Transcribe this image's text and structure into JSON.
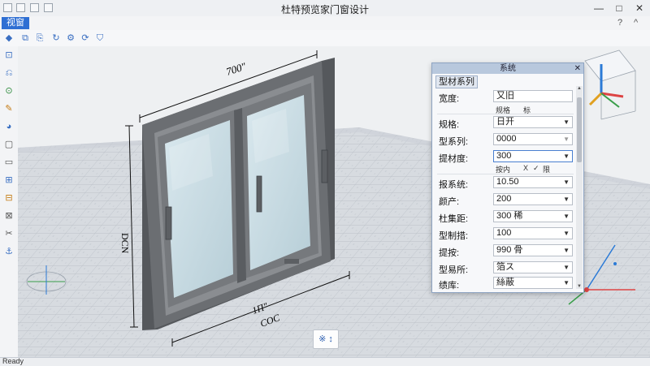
{
  "window": {
    "title": "杜特预览家门窗设计",
    "min": "—",
    "max": "□",
    "close": "✕"
  },
  "menu": {
    "active_tab": "视窗",
    "right_icons": [
      "?",
      "^"
    ]
  },
  "toolbar": {
    "icons": [
      "back-icon",
      "copy-icon",
      "paste-icon",
      "rotate-icon",
      "settings-icon",
      "refresh-icon",
      "tag-icon"
    ],
    "glyphs": [
      "◆",
      "⧉",
      "⎘",
      "↻",
      "⚙",
      "⟳",
      "⛉"
    ]
  },
  "left_tools": {
    "glyphs": [
      "⊡",
      "⎌",
      "⊙",
      "✎",
      "◕",
      "▢",
      "▭",
      "⊞",
      "⊟",
      "⊠",
      "✂",
      "⚓"
    ]
  },
  "drawing": {
    "dim_top": "700\"",
    "dim_left": "DCN",
    "dim_bottom_1": "1Π\"",
    "dim_bottom_2": "COC"
  },
  "bottom_button": "※ ↕",
  "status": "Ready",
  "panel": {
    "title": "系统",
    "close": "✕",
    "tab": "型材系列",
    "width_label": "宽度:",
    "width_value": "又旧",
    "width_sub_1": "规格",
    "width_sub_2": "标",
    "rows": [
      {
        "label": "规格:",
        "value": "日开"
      },
      {
        "label": "型系列:",
        "value": "0000"
      },
      {
        "label": "提材度:",
        "value": "300"
      },
      {
        "label": "报系统:",
        "value": "10.50"
      },
      {
        "label": "颜产:",
        "value": "200"
      },
      {
        "label": "杜集距:",
        "value": "300 稀"
      },
      {
        "label": "型制措:",
        "value": "100"
      },
      {
        "label": "提按:",
        "value": "990 骨"
      },
      {
        "label": "型易所:",
        "value": "箔ス"
      },
      {
        "label": "绩库:",
        "value": "絲蔽"
      }
    ],
    "sub_row": {
      "a": "按内",
      "b": "X",
      "c": "✓",
      "d": "限"
    }
  },
  "colors": {
    "frame": "#6b6e72",
    "frame_dark": "#4f5256",
    "glass": "#c6dbe2",
    "accent": "#2f6fd3"
  }
}
